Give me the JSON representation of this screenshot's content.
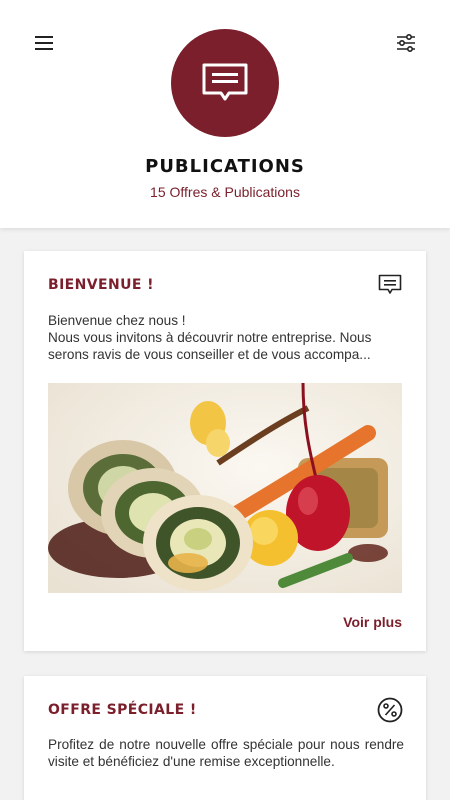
{
  "header": {
    "title": "PUBLICATIONS",
    "subtitle": "15 Offres & Publications",
    "menu_icon": "hamburger-menu-icon",
    "filter_icon": "filter-sliders-icon",
    "avatar_icon": "message-icon"
  },
  "colors": {
    "accent": "#7a1f2b",
    "background": "#f2f2f2",
    "card": "#ffffff"
  },
  "cards": [
    {
      "title": "BIENVENUE !",
      "icon": "message-icon",
      "lines": [
        "Bienvenue chez nous !",
        "Nous vous invitons à découvrir notre entreprise. Nous",
        "serons ravis de vous conseiller et de vous accompa..."
      ],
      "image": "plated-food-image",
      "link": "Voir plus"
    },
    {
      "title": "OFFRE SPÉCIALE !",
      "icon": "percent-badge-icon",
      "text": "Profitez de notre nouvelle offre spéciale pour nous rendre visite et bénéficiez d'une remise exceptionnelle."
    }
  ]
}
